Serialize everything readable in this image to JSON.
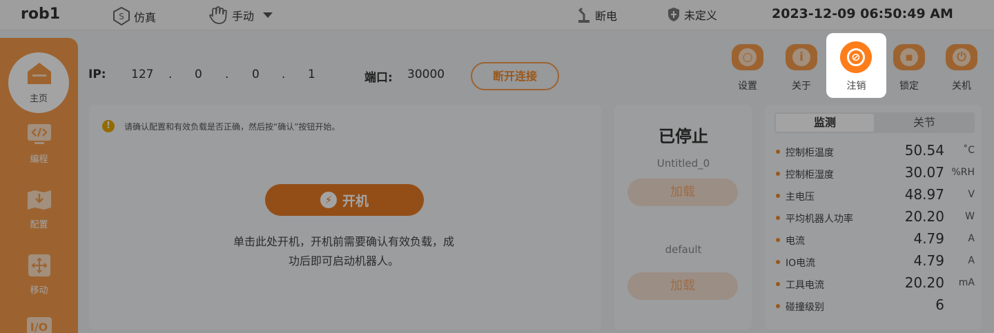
{
  "topbar": {
    "robot_name": "rob1",
    "mode_label": "仿真",
    "control_label": "手动",
    "power_status": "断电",
    "safety_status": "未定义",
    "datetime": "2023-12-09 06:50:49 AM"
  },
  "sidebar": {
    "items": [
      {
        "label": "主页",
        "icon": "home-icon"
      },
      {
        "label": "编程",
        "icon": "code-icon"
      },
      {
        "label": "配置",
        "icon": "config-icon"
      },
      {
        "label": "移动",
        "icon": "move-icon"
      },
      {
        "label": "I/O",
        "icon": "io-icon"
      }
    ]
  },
  "connection": {
    "ip_label": "IP:",
    "ip": [
      "127",
      "0",
      "0",
      "1"
    ],
    "dot": ".",
    "port_label": "端口:",
    "port": "30000",
    "disconnect_label": "断开连接"
  },
  "toolbar": {
    "items": [
      {
        "label": "设置",
        "icon": "settings-icon",
        "glyph": "○"
      },
      {
        "label": "关于",
        "icon": "info-icon",
        "glyph": "i"
      },
      {
        "label": "注销",
        "icon": "logout-icon",
        "glyph": "⊘"
      },
      {
        "label": "锁定",
        "icon": "lock-icon",
        "glyph": "▪"
      },
      {
        "label": "关机",
        "icon": "power-icon",
        "glyph": "⏻"
      }
    ]
  },
  "main": {
    "notice": "请确认配置和有效负载是否正确，然后按“确认”按钮开始。",
    "power_on_label": "开机",
    "hint_line1": "单击此处开机，开机前需要确认有效负载，成",
    "hint_line2": "功后即可启动机器人。"
  },
  "status": {
    "title": "已停止",
    "program_name": "Untitled_0",
    "load_label": "加载",
    "payload_name": "default",
    "load_label_2": "加载"
  },
  "monitor": {
    "tabs": [
      "监测",
      "关节"
    ],
    "rows": [
      {
        "name": "控制柜温度",
        "value": "50.54",
        "unit": "˚C"
      },
      {
        "name": "控制柜湿度",
        "value": "30.07",
        "unit": "%RH"
      },
      {
        "name": "主电压",
        "value": "48.97",
        "unit": "V"
      },
      {
        "name": "平均机器人功率",
        "value": "20.20",
        "unit": "W"
      },
      {
        "name": "电流",
        "value": "4.79",
        "unit": "A"
      },
      {
        "name": "IO电流",
        "value": "4.79",
        "unit": "A"
      },
      {
        "name": "工具电流",
        "value": "20.20",
        "unit": "mA"
      },
      {
        "name": "碰撞级别",
        "value": "6",
        "unit": ""
      }
    ]
  },
  "colors": {
    "accent": "#f59c4b",
    "accent_dark": "#e77a24",
    "active_tool": "#fd7d1a"
  }
}
